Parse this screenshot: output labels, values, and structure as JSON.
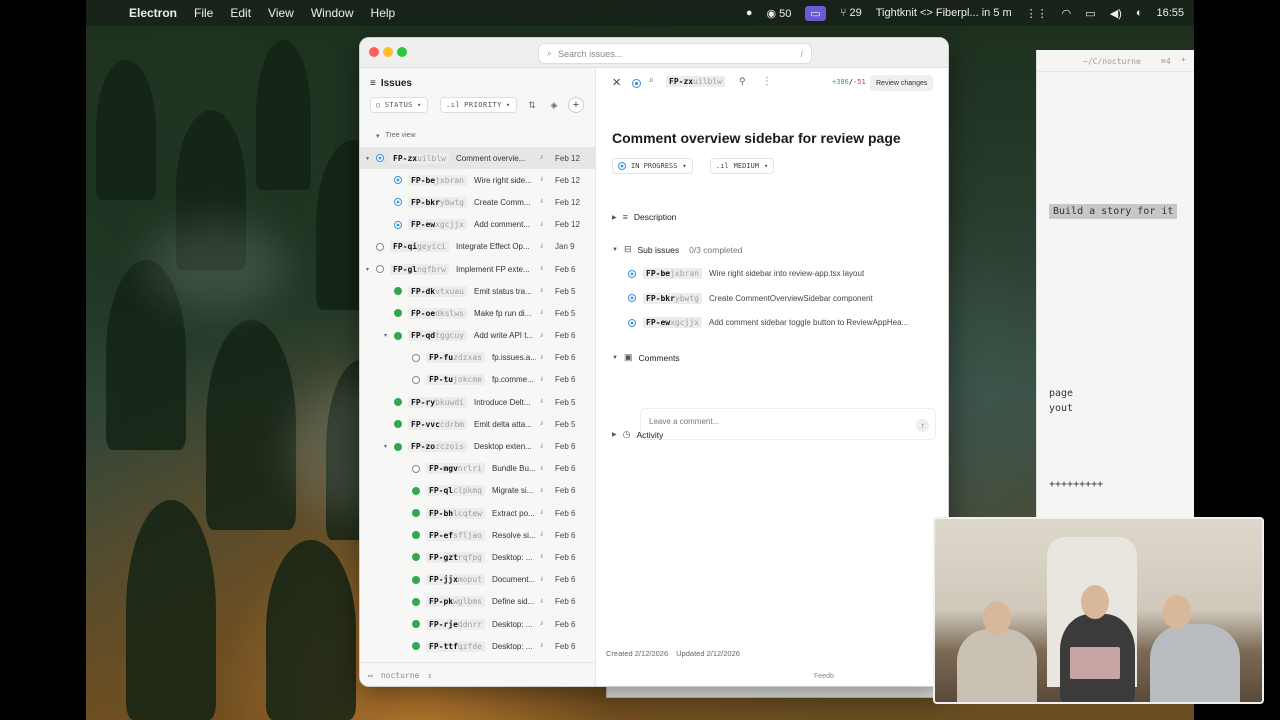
{
  "menubar": {
    "app": "Electron",
    "items": [
      "File",
      "Edit",
      "View",
      "Window",
      "Help"
    ],
    "github_count": "50",
    "pr_count": "29",
    "meeting": "Tightknit <> Fiberpl... in 5 m",
    "clock": "16:55"
  },
  "window": {
    "search_placeholder": "Search issues...",
    "search_shortcut": "/"
  },
  "issues_pane": {
    "title": "Issues",
    "status_filter": "STATUS",
    "priority_filter": "PRIORITY",
    "tree_view_label": "Tree view",
    "workspace": "nocturne",
    "rows": [
      {
        "caret": "▾",
        "level": 0,
        "status": "prog",
        "id_bold": "FP-zx",
        "id_rest": "uilblw",
        "title": "Comment overvie...",
        "priority": ".ıl",
        "date": "Feb 12",
        "selected": true
      },
      {
        "caret": "",
        "level": 1,
        "status": "prog",
        "id_bold": "FP-be",
        "id_rest": "jxbran",
        "title": "Wire right side...",
        "priority": ".ıl",
        "date": "Feb 12"
      },
      {
        "caret": "",
        "level": 1,
        "status": "prog",
        "id_bold": "FP-bkr",
        "id_rest": "ybwtg",
        "title": "Create Comm...",
        "priority": ".ıl",
        "date": "Feb 12"
      },
      {
        "caret": "",
        "level": 1,
        "status": "prog",
        "id_bold": "FP-ew",
        "id_rest": "xgcjjx",
        "title": "Add comment...",
        "priority": ".ıl",
        "date": "Feb 12"
      },
      {
        "caret": "",
        "level": 0,
        "status": "todo",
        "id_bold": "FP-qi",
        "id_rest": "geyici",
        "title": "Integrate Effect Op...",
        "priority": ".ıl",
        "date": "Jan 9"
      },
      {
        "caret": "▾",
        "level": 0,
        "status": "todo",
        "id_bold": "FP-gl",
        "id_rest": "nqfbrw",
        "title": "Implement FP exte...",
        "priority": ".ıl",
        "date": "Feb 6"
      },
      {
        "caret": "",
        "level": 1,
        "status": "done",
        "id_bold": "FP-dk",
        "id_rest": "vtxuau",
        "title": "Emit status tra...",
        "priority": ".ıl",
        "date": "Feb 5"
      },
      {
        "caret": "",
        "level": 1,
        "status": "done",
        "id_bold": "FP-oe",
        "id_rest": "dkslws",
        "title": "Make fp run di...",
        "priority": ".ıl",
        "date": "Feb 5"
      },
      {
        "caret": "▾",
        "level": 1,
        "status": "done",
        "id_bold": "FP-qd",
        "id_rest": "tggcuy",
        "title": "Add write API t...",
        "priority": ".ıl",
        "date": "Feb 6"
      },
      {
        "caret": "",
        "level": 2,
        "status": "todo",
        "id_bold": "FP-fu",
        "id_rest": "zdzxas",
        "title": "fp.issues.a...",
        "priority": ".ıl",
        "date": "Feb 6"
      },
      {
        "caret": "",
        "level": 2,
        "status": "todo",
        "id_bold": "FP-tu",
        "id_rest": "jokcme",
        "title": "fp.comme...",
        "priority": ".ıl",
        "date": "Feb 6"
      },
      {
        "caret": "",
        "level": 1,
        "status": "done",
        "id_bold": "FP-ry",
        "id_rest": "bkuwdi",
        "title": "Introduce Delt...",
        "priority": ".ıl",
        "date": "Feb 5"
      },
      {
        "caret": "",
        "level": 1,
        "status": "done",
        "id_bold": "FP-vvc",
        "id_rest": "cdrbm",
        "title": "Emit delta atta...",
        "priority": ".ıl",
        "date": "Feb 5"
      },
      {
        "caret": "▾",
        "level": 1,
        "status": "done",
        "id_bold": "FP-zo",
        "id_rest": "zczois",
        "title": "Desktop exten...",
        "priority": ".ıl",
        "date": "Feb 6"
      },
      {
        "caret": "",
        "level": 2,
        "status": "todo",
        "id_bold": "FP-mgv",
        "id_rest": "nrlri",
        "title": "Bundle Bu...",
        "priority": ".ıl",
        "date": "Feb 6"
      },
      {
        "caret": "",
        "level": 2,
        "status": "done",
        "id_bold": "FP-ql",
        "id_rest": "clpkmq",
        "title": "Migrate si...",
        "priority": ".ıl",
        "date": "Feb 6"
      },
      {
        "caret": "",
        "level": 2,
        "status": "done",
        "id_bold": "FP-bh",
        "id_rest": "lcqtew",
        "title": "Extract po...",
        "priority": ".ıl",
        "date": "Feb 6"
      },
      {
        "caret": "",
        "level": 2,
        "status": "done",
        "id_bold": "FP-ef",
        "id_rest": "sfljao",
        "title": "Resolve si...",
        "priority": ".ıl",
        "date": "Feb 6"
      },
      {
        "caret": "",
        "level": 2,
        "status": "done",
        "id_bold": "FP-gzt",
        "id_rest": "rqfpg",
        "title": "Desktop: ...",
        "priority": ".ıl",
        "date": "Feb 6"
      },
      {
        "caret": "",
        "level": 2,
        "status": "done",
        "id_bold": "FP-jjx",
        "id_rest": "moput",
        "title": "Document...",
        "priority": ".ıl",
        "date": "Feb 6"
      },
      {
        "caret": "",
        "level": 2,
        "status": "done",
        "id_bold": "FP-pk",
        "id_rest": "wglbms",
        "title": "Define sid...",
        "priority": ".ıl",
        "date": "Feb 6"
      },
      {
        "caret": "",
        "level": 2,
        "status": "done",
        "id_bold": "FP-rje",
        "id_rest": "ddnrr",
        "title": "Desktop: ...",
        "priority": ".ıl",
        "date": "Feb 6"
      },
      {
        "caret": "",
        "level": 2,
        "status": "done",
        "id_bold": "FP-ttf",
        "id_rest": "qzfde",
        "title": "Desktop: ...",
        "priority": ".ıl",
        "date": "Feb 6"
      }
    ]
  },
  "detail": {
    "id_bold": "FP-zx",
    "id_rest": "uilblw",
    "additions": "+386",
    "separator": "/",
    "deletions": "-51",
    "review_button": "Review changes",
    "title": "Comment overview sidebar for review page",
    "status": "IN PROGRESS",
    "priority": "MEDIUM",
    "description_label": "Description",
    "sub_issues_label": "Sub issues",
    "sub_issues_progress": "0/3 completed",
    "sub_issues": [
      {
        "id_bold": "FP-be",
        "id_rest": "jxbran",
        "title": "Wire right sidebar into review-app.tsx layout"
      },
      {
        "id_bold": "FP-bkr",
        "id_rest": "ybwtg",
        "title": "Create CommentOverviewSidebar component"
      },
      {
        "id_bold": "FP-ew",
        "id_rest": "xgcjjx",
        "title": "Add comment sidebar toggle button to ReviewAppHea..."
      }
    ],
    "comments_label": "Comments",
    "comment_placeholder": "Leave a comment...",
    "activity_label": "Activity",
    "created": "Created 2/12/2026",
    "updated": "Updated 2/12/2026",
    "feedback": "Feedb"
  },
  "code_window": {
    "path": "~/C/nocturne",
    "shortcut": "⌘4",
    "highlight": "Build a story for it",
    "lines": [
      "page",
      "yout",
      "+++++++++"
    ]
  },
  "colors": {
    "progress": "#3d8fe0",
    "done": "#2fa84f",
    "add": "#2fa84f",
    "del": "#dd3333"
  }
}
